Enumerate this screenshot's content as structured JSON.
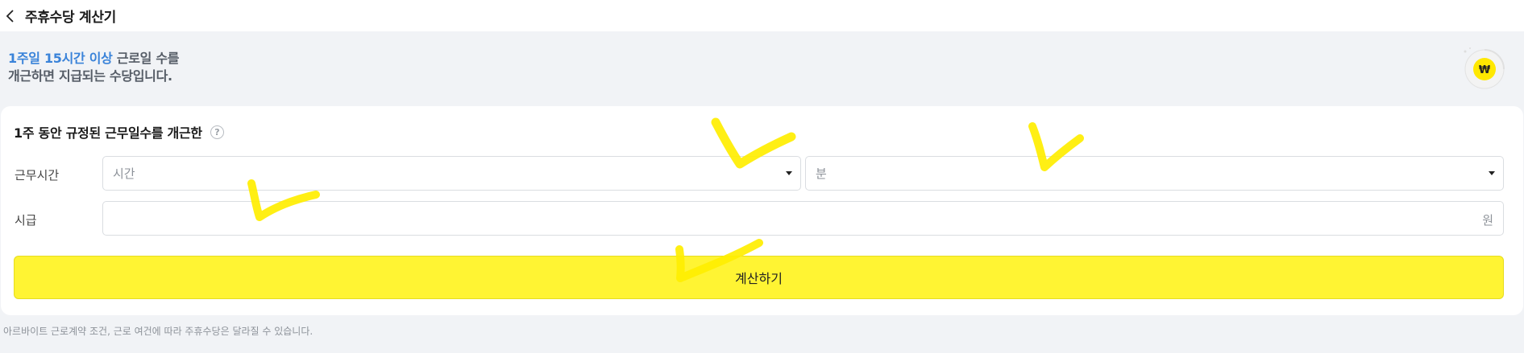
{
  "header": {
    "title": "주휴수당 계산기",
    "back_icon": "chevron-left-icon"
  },
  "banner": {
    "highlight": "1주일 15시간 이상",
    "line1_rest": " 근로일 수를",
    "line2": "개근하면 지급되는 수당입니다.",
    "icon": "won-coin-icon",
    "colors": {
      "highlight": "#3a83d9",
      "coin": "#ffe800"
    }
  },
  "form": {
    "title": "1주 동안 규정된 근무일수를 개근한",
    "help_icon_glyph": "?",
    "work_time": {
      "label": "근무시간",
      "hours_placeholder": "시간",
      "minutes_placeholder": "분"
    },
    "wage": {
      "label": "시급",
      "unit": "원",
      "value": ""
    },
    "submit_label": "계산하기"
  },
  "footnote": "아르바이트 근로계약 조건, 근로 여건에 따라 주휴수당은 달라질 수 있습니다.",
  "colors": {
    "button": "#fff433",
    "annotation": "#ffee00"
  }
}
